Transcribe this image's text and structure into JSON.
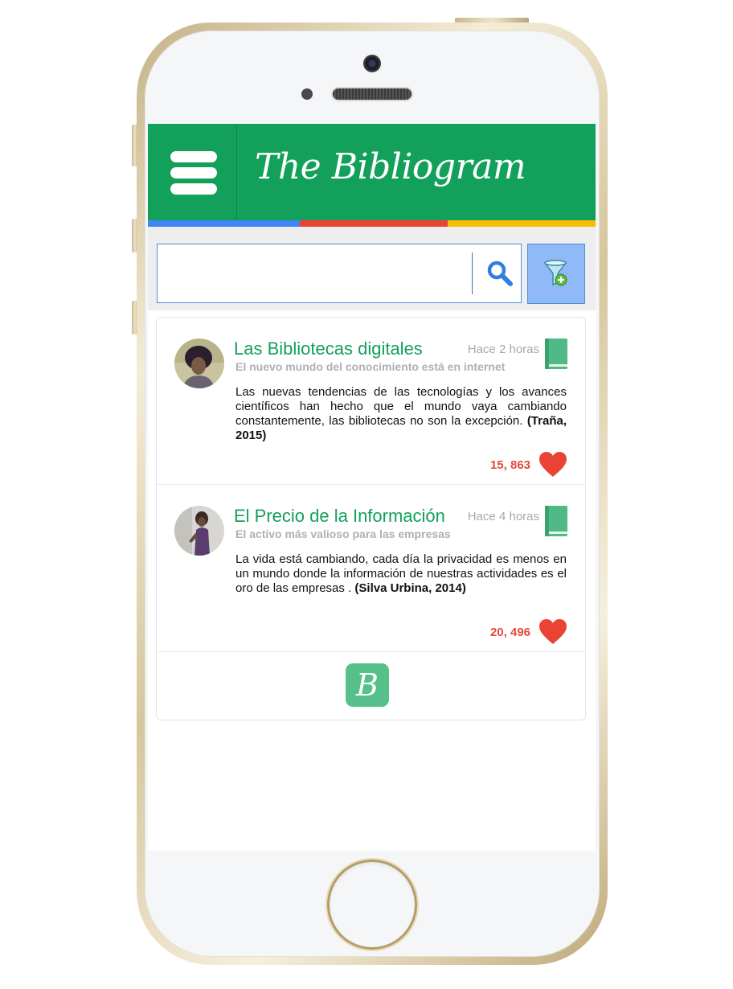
{
  "app": {
    "title": "The Bibliogram",
    "colors": {
      "header": "#12a05b",
      "stripe": [
        "#4285f4",
        "#ea4335",
        "#fbbc05"
      ],
      "accent_red": "#e34a3b",
      "filter_button": "#8fb9f7"
    }
  },
  "search": {
    "value": "",
    "placeholder": "",
    "search_icon": "magnifier-icon",
    "filter_icon": "funnel-add-icon"
  },
  "posts": [
    {
      "title": "Las Bibliotecas digitales",
      "subtitle": "El nuevo mundo del conocimiento está en internet",
      "time": "Hace 2 horas",
      "body": "Las nuevas tendencias de las tecnologías y los avances científicos han hecho que el mundo vaya cambiando constantemente, las bibliotecas no son la excepción.",
      "citation": "(Traña, 2015)",
      "likes": "15, 863"
    },
    {
      "title": "El Precio de la Información",
      "subtitle": "El activo más valioso para las empresas",
      "time": "Hace 4 horas",
      "body": "La vida está cambiando, cada día la privacidad es menos en un mundo donde la información de nuestras actividades es el oro de las empresas .",
      "citation": "(Silva Urbina, 2014)",
      "likes": "20, 496"
    }
  ],
  "footer": {
    "logo_letter": "B"
  }
}
